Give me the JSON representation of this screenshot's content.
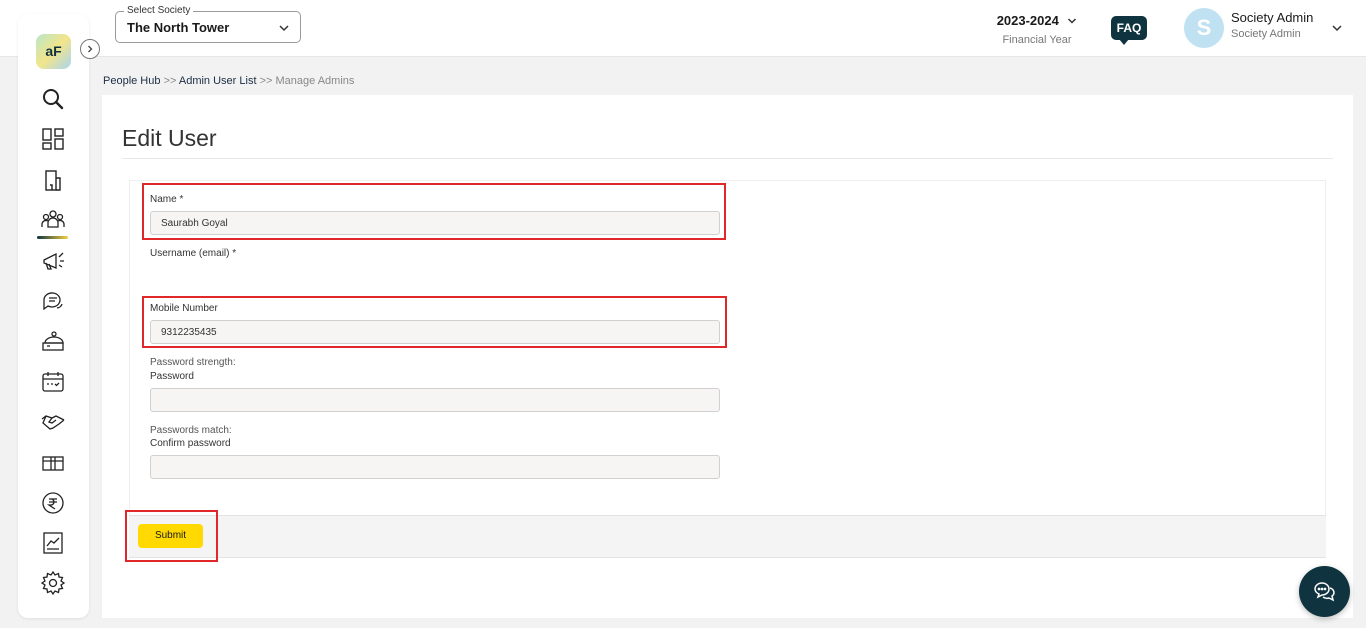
{
  "header": {
    "society_legend": "Select Society",
    "society_value": "The North Tower",
    "financial_year": "2023-2024",
    "financial_year_label": "Financial Year",
    "faq_label": "FAQ",
    "avatar_initial": "S",
    "user_name": "Society Admin",
    "user_role": "Society Admin"
  },
  "sidebar": {
    "logo_text": "aF",
    "items": [
      {
        "icon": "search-icon"
      },
      {
        "icon": "dashboard-icon"
      },
      {
        "icon": "building-icon"
      },
      {
        "icon": "people-hub-icon"
      },
      {
        "icon": "announcement-icon"
      },
      {
        "icon": "chat-icon"
      },
      {
        "icon": "service-icon"
      },
      {
        "icon": "calendar-icon"
      },
      {
        "icon": "handshake-icon"
      },
      {
        "icon": "parcel-icon"
      },
      {
        "icon": "rupee-icon"
      },
      {
        "icon": "report-icon"
      },
      {
        "icon": "settings-icon"
      }
    ]
  },
  "breadcrumb": {
    "item1": "People Hub",
    "sep1": ">>",
    "item2": "Admin User List",
    "sep2": ">>",
    "item3": "Manage Admins"
  },
  "page": {
    "title": "Edit User"
  },
  "form": {
    "name_label": "Name *",
    "name_value": "Saurabh Goyal",
    "username_label": "Username (email) *",
    "mobile_label": "Mobile Number",
    "mobile_value": "9312235435",
    "password_strength": "Password strength:",
    "password_label": "Password",
    "password_value": "",
    "passwords_match": "Passwords match:",
    "confirm_password_label": "Confirm password",
    "confirm_password_value": "",
    "submit_label": "Submit"
  },
  "colors": {
    "accent_dark": "#0f3440",
    "submit_yellow": "#ffd900",
    "highlight_red": "#e0272a"
  }
}
